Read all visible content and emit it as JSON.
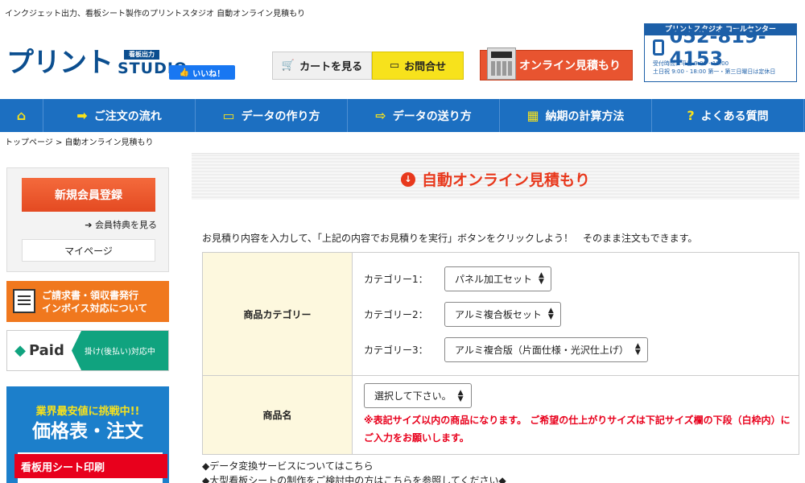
{
  "header": {
    "tagline": "インクジェット出力、看板シート製作のプリントスタジオ 自動オンライン見積もり",
    "logo_main": "プリント",
    "logo_badge": "看板出力",
    "logo_studio": "STUDIO",
    "like_label": "いいね！",
    "cart_label": "カートを見る",
    "contact_label": "お問合せ",
    "quote_label": "オンライン見積もり",
    "callcenter": {
      "title": "プリントスタジオ コールセンター",
      "phone": "052-819-4153",
      "hours1": "受付時間：平日 9:00 - 19:00",
      "hours2": "土日祝 9:00 - 18:00 第一・第三日曜日は定休日"
    }
  },
  "nav": {
    "home_icon": "home-icon",
    "items": [
      {
        "icon": "➡",
        "label": "ご注文の流れ"
      },
      {
        "icon": "▭",
        "label": "データの作り方"
      },
      {
        "icon": "⇨",
        "label": "データの送り方"
      },
      {
        "icon": "▦",
        "label": "納期の計算方法"
      },
      {
        "icon": "?",
        "label": "よくある質問"
      }
    ]
  },
  "breadcrumb": "トップページ  >  自動オンライン見積もり",
  "sidebar": {
    "register": "新規会員登録",
    "benefit": "会員特典を見る",
    "mypage": "マイページ",
    "invoice_line1": "ご請求書・領収書発行",
    "invoice_line2": "インボイス対応について",
    "paid_logo": "Paid",
    "paid_text": "掛け(後払い)対応中",
    "price_sub": "業界最安値に挑戦中!!",
    "price_main": "価格表・注文",
    "price_tag": "看板用シート印刷"
  },
  "main": {
    "title": "自動オンライン見積もり",
    "intro": "お見積り内容を入力して、「上記の内容でお見積りを実行」ボタンをクリックしよう！　そのまま注文もできます。",
    "category_header": "商品カテゴリー",
    "categories": [
      {
        "label": "カテゴリー1：",
        "value": "パネル加工セット"
      },
      {
        "label": "カテゴリー2：",
        "value": "アルミ複合板セット"
      },
      {
        "label": "カテゴリー3：",
        "value": "アルミ複合版（片面仕様・光沢仕上げ）"
      }
    ],
    "product_header": "商品名",
    "product_select": "選択して下さい。",
    "note": "※表記サイズ以内の商品になります。 ご希望の仕上がりサイズは下記サイズ欄の下段（白枠内）にご入力をお願いします。",
    "link1": "◆データ変換サービスについてはこちら",
    "link2": "◆大型看板シートの制作をご検討中の方はこちらを参照してください◆"
  }
}
